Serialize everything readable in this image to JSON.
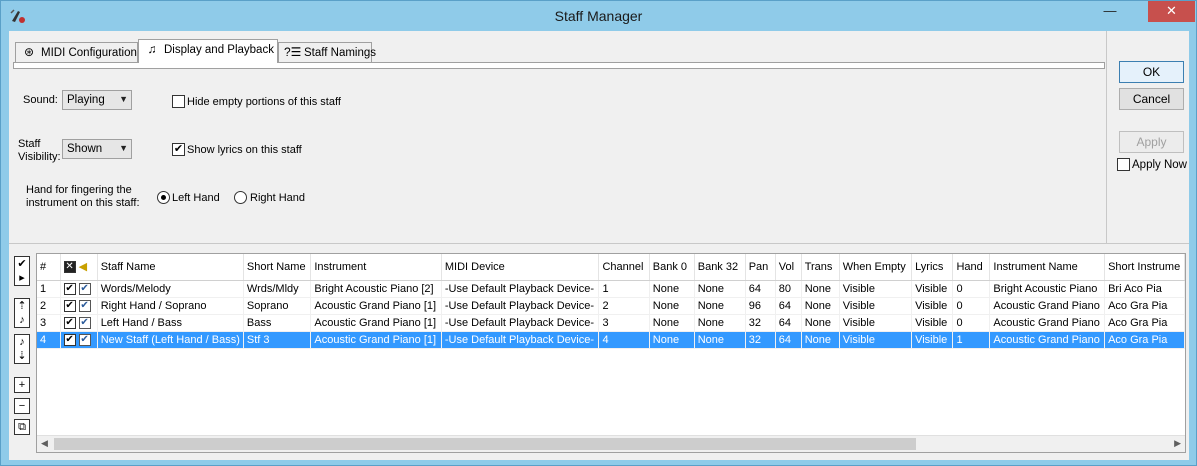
{
  "window": {
    "title": "Staff Manager",
    "minimize_glyph": "—",
    "close_glyph": "✕"
  },
  "tabs": [
    {
      "label": "MIDI Configuration",
      "icon": "midi-plug-icon"
    },
    {
      "label": "Display and Playback",
      "icon": "music-notes-icon"
    },
    {
      "label": "Staff Namings",
      "icon": "list-icon"
    }
  ],
  "display": {
    "sound_label": "Sound:",
    "sound_value": "Playing",
    "hide_empty_label": "Hide empty portions of this staff",
    "hide_empty_checked": false,
    "visibility_label_line1": "Staff",
    "visibility_label_line2": "Visibility:",
    "visibility_value": "Shown",
    "show_lyrics_label": "Show lyrics on this staff",
    "show_lyrics_checked": true,
    "hand_label_line1": "Hand for fingering the",
    "hand_label_line2": "instrument on this staff:",
    "left_hand_label": "Left Hand",
    "right_hand_label": "Right Hand",
    "selected_hand": "Left Hand"
  },
  "buttons": {
    "ok": "OK",
    "cancel": "Cancel",
    "apply": "Apply",
    "apply_now": "Apply Now"
  },
  "grid": {
    "columns": [
      "#",
      "",
      "Staff Name",
      "Short Name",
      "Instrument",
      "MIDI Device",
      "Channel",
      "Bank 0",
      "Bank 32",
      "Pan",
      "Vol",
      "Trans",
      "When Empty",
      "Lyrics",
      "Hand",
      "Instrument Name",
      "Short Instrume"
    ],
    "rows": [
      {
        "num": "1",
        "name": "Words/Melody",
        "short": "Wrds/Mldy",
        "instrument": "Bright Acoustic Piano [2]",
        "device": "-Use Default Playback Device-",
        "channel": "1",
        "bank0": "None",
        "bank32": "None",
        "pan": "64",
        "vol": "80",
        "trans": "None",
        "when_empty": "Visible",
        "lyrics": "Visible",
        "hand": "0",
        "inst_name": "Bright Acoustic Piano",
        "short_inst": "Bri Aco Pia"
      },
      {
        "num": "2",
        "name": "Right Hand / Soprano",
        "short": "Soprano",
        "instrument": "Acoustic Grand Piano [1]",
        "device": "-Use Default Playback Device-",
        "channel": "2",
        "bank0": "None",
        "bank32": "None",
        "pan": "96",
        "vol": "64",
        "trans": "None",
        "when_empty": "Visible",
        "lyrics": "Visible",
        "hand": "0",
        "inst_name": "Acoustic Grand Piano",
        "short_inst": "Aco Gra Pia"
      },
      {
        "num": "3",
        "name": "Left Hand / Bass",
        "short": "Bass",
        "instrument": "Acoustic Grand Piano [1]",
        "device": "-Use Default Playback Device-",
        "channel": "3",
        "bank0": "None",
        "bank32": "None",
        "pan": "32",
        "vol": "64",
        "trans": "None",
        "when_empty": "Visible",
        "lyrics": "Visible",
        "hand": "0",
        "inst_name": "Acoustic Grand Piano",
        "short_inst": "Aco Gra Pia"
      },
      {
        "num": "4",
        "name": "New Staff (Left Hand / Bass)",
        "short": "Stf 3",
        "instrument": "Acoustic Grand Piano [1]",
        "device": "-Use Default Playback Device-",
        "channel": "4",
        "bank0": "None",
        "bank32": "None",
        "pan": "32",
        "vol": "64",
        "trans": "None",
        "when_empty": "Visible",
        "lyrics": "Visible",
        "hand": "1",
        "inst_name": "Acoustic Grand Piano",
        "short_inst": "Aco Gra Pia"
      }
    ],
    "selected_row": "4"
  },
  "colors": {
    "titlebar": "#8fcbe9",
    "close_button": "#c7504d",
    "selection": "#3399ff"
  }
}
